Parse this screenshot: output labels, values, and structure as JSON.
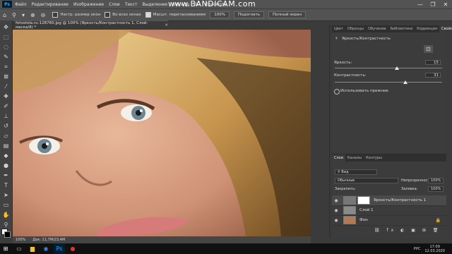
{
  "watermark": "www.BANDICAM.com",
  "menu": {
    "app_icon": "Ps",
    "items": [
      "Файл",
      "Редактирование",
      "Изображение",
      "Слои",
      "Текст",
      "Выделение",
      "Фильтр",
      "3D",
      "Просмотр"
    ]
  },
  "window_controls": {
    "minimize": "—",
    "maximize": "❐",
    "close": "✕"
  },
  "options_bar": {
    "zoom_icon": "magnifier-icon",
    "check1_label": "Настр. размер окон",
    "check2_label": "Во всех окнах",
    "check3_label": "Масшт. перетаскиванием",
    "zoom_value": "100%",
    "fit_button": "Подогнать",
    "fullscreen_button": "Полный экран"
  },
  "document": {
    "tab_title": "fotostola.ru-128760.jpg @ 100% (Яркость/Контрастность 1, Слой-маска/8) *",
    "status_zoom": "100%",
    "status_doc": "Док: 11,7М/23,4М"
  },
  "properties": {
    "tabs": [
      "Цвет",
      "Образцы",
      "Обучение",
      "Библиотеки",
      "Коррекция",
      "Свойства"
    ],
    "active_tab": "Свойства",
    "adjustment_name": "Яркость/Контрастность",
    "brightness_label": "Яркость:",
    "brightness_value": "15",
    "brightness_fraction": 0.58,
    "contrast_label": "Контрастность:",
    "contrast_value": "31",
    "contrast_fraction": 0.66,
    "legacy_label": "Использовать прежние"
  },
  "layers": {
    "tabs": [
      "Слои",
      "Каналы",
      "Контуры"
    ],
    "filter_label": "Вид",
    "blend_mode": "Обычные",
    "opacity_label": "Непрозрачность:",
    "opacity_value": "100%",
    "lock_label": "Закрепить:",
    "fill_label": "Заливка:",
    "fill_value": "100%",
    "items": [
      {
        "name": "Яркость/Контрастность 1"
      },
      {
        "name": "Слой 1"
      },
      {
        "name": "Фон"
      }
    ]
  },
  "taskbar": {
    "language": "РУС",
    "time": "17:09",
    "date": "12.03.2020"
  },
  "colors": {
    "accent": "#31a8ff",
    "panel": "#3c3c3c",
    "chrome": "#535353"
  }
}
